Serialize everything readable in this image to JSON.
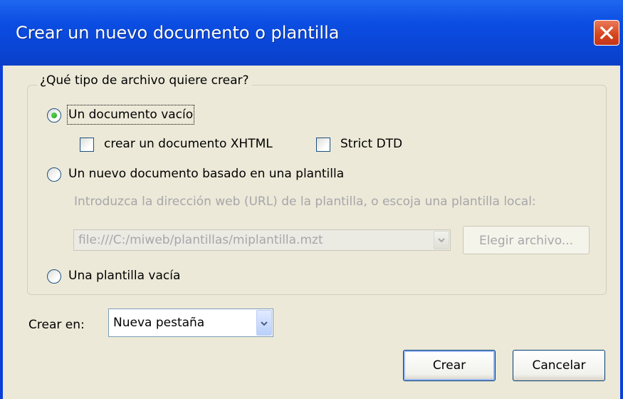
{
  "dialog": {
    "title": "Crear un nuevo documento o plantilla",
    "close_icon": "close-icon"
  },
  "file_type_group": {
    "legend": "¿Qué tipo de archivo quiere crear?",
    "option_empty_document": {
      "label": "Un documento vacío",
      "selected": true
    },
    "xhtml_checkbox": {
      "label": "crear un documento XHTML",
      "checked": false
    },
    "strict_dtd_checkbox": {
      "label": "Strict DTD",
      "checked": false
    },
    "option_template_document": {
      "label": "Un nuevo documento basado en una plantilla",
      "selected": false
    },
    "template_hint": "Introduzca la dirección web (URL) de la plantilla, o escoja una plantilla local:",
    "template_url": "file:///C:/miweb/plantillas/miplantilla.mzt",
    "choose_file_button": "Elegir archivo...",
    "option_empty_template": {
      "label": "Una plantilla vacía",
      "selected": false
    }
  },
  "create_in": {
    "label": "Crear en:",
    "selected": "Nueva pestaña"
  },
  "buttons": {
    "create": "Crear",
    "cancel": "Cancelar"
  },
  "colors": {
    "titlebar": "#0a47d8",
    "dialog_bg": "#ece9d8",
    "disabled_text": "#a7a6aa",
    "close_button": "#d6441c"
  }
}
